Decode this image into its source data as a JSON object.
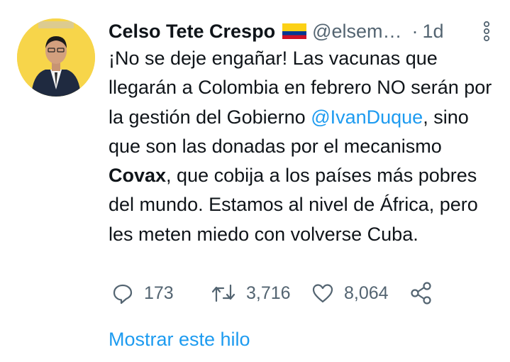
{
  "tweet": {
    "author_name": "Celso Tete Crespo",
    "handle": "@elsem…",
    "separator": "·",
    "time": "1d",
    "text_parts": {
      "p1": "¡No se deje engañar! Las vacunas que llegarán a Colombia en febrero NO serán por la gestión del Gobierno ",
      "mention": "@IvanDuque",
      "p2": ", sino que son las donadas por el mecanismo ",
      "bold": "Covax",
      "p3": ", que cobija a los países más pobres del mundo. Estamos al nivel de África, pero les meten miedo con volverse Cuba."
    },
    "actions": {
      "reply_count": "173",
      "retweet_count": "3,716",
      "like_count": "8,064"
    },
    "show_thread": "Mostrar este hilo",
    "icons": {
      "flag": "colombia-flag-icon",
      "more": "more-vertical-icon",
      "reply": "reply-icon",
      "retweet": "retweet-icon",
      "like": "heart-icon",
      "share": "share-icon"
    },
    "colors": {
      "accent": "#1d9bf0",
      "secondary_text": "#536471",
      "primary_text": "#0f1419",
      "avatar_bg": "#f7d54a"
    }
  }
}
